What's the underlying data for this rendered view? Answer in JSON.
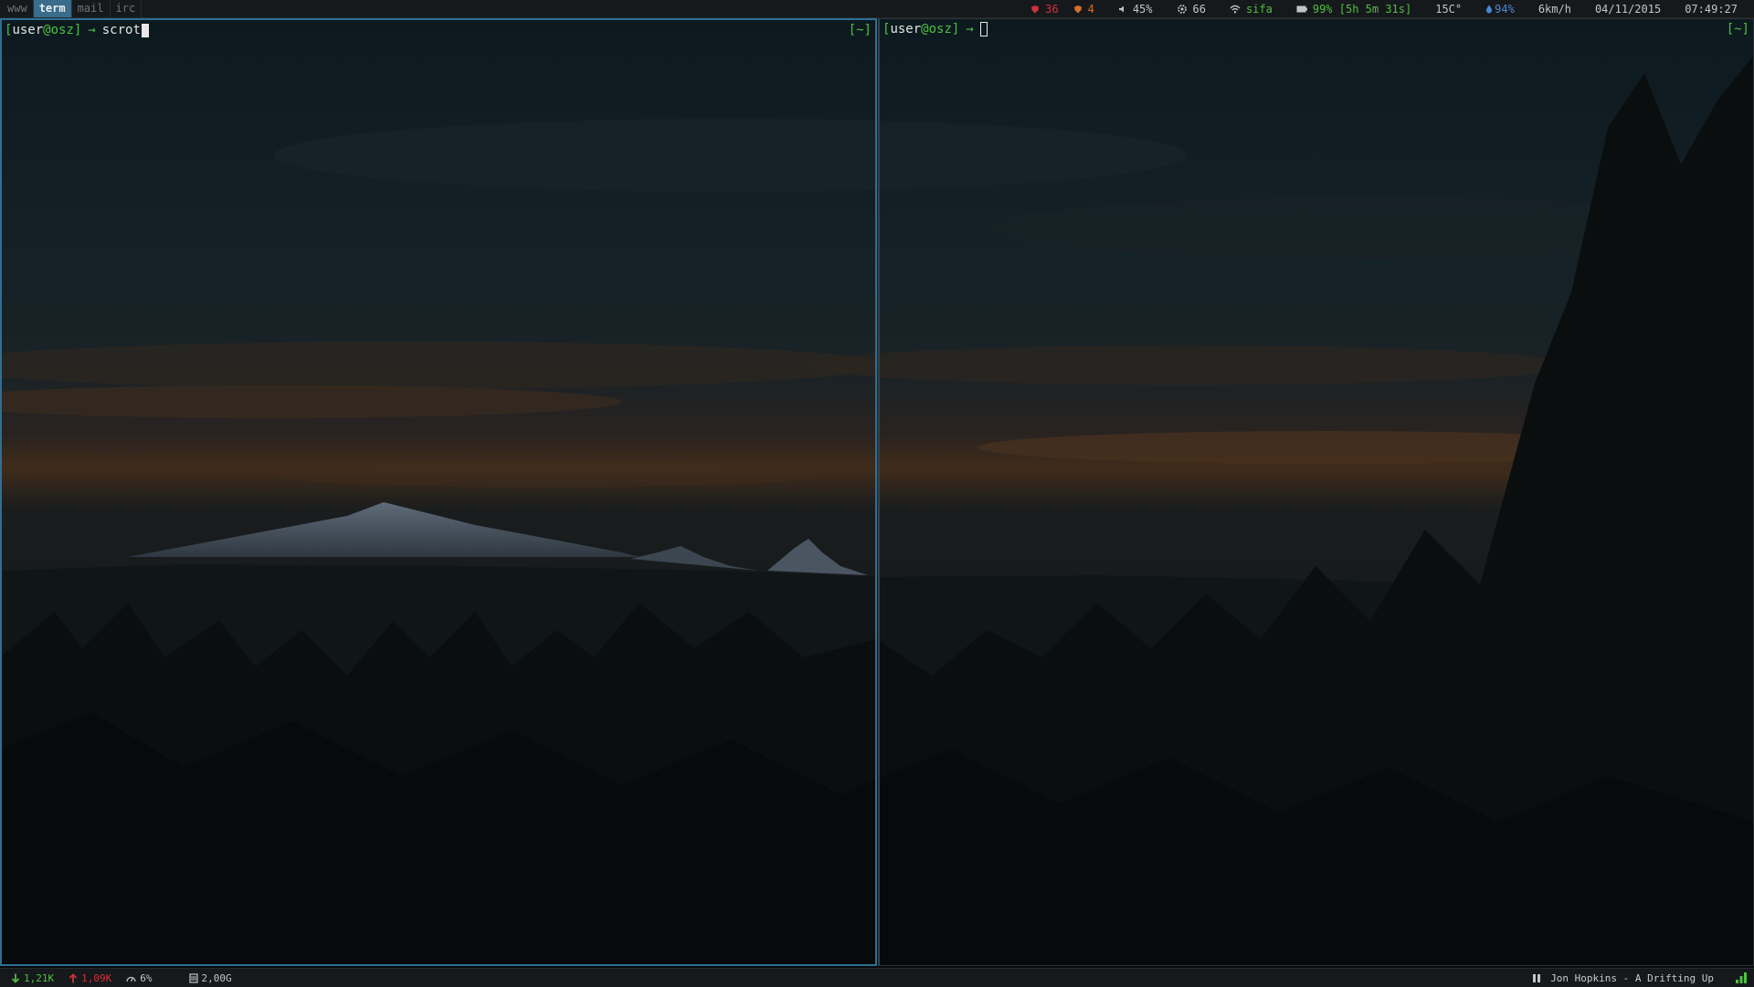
{
  "workspaces": [
    {
      "label": "www",
      "active": false
    },
    {
      "label": "term",
      "active": true
    },
    {
      "label": "mail",
      "active": false
    },
    {
      "label": "irc",
      "active": false
    }
  ],
  "status": {
    "updates_arch": "36",
    "updates_aur": "4",
    "volume": "45%",
    "cpu_load": "66",
    "wifi_ssid": "sifa",
    "battery": "99% [5h 5m 31s]",
    "temperature": "15C°",
    "humidity": "94%",
    "wind": "6km/h",
    "date": "04/11/2015",
    "time": "07:49:27"
  },
  "terminal_left": {
    "bracket_open": "[",
    "user": "user",
    "host": "@osz",
    "bracket_close": "]",
    "arrow": "→",
    "command": "scrot",
    "cwd": "[~]"
  },
  "terminal_right": {
    "bracket_open": "[",
    "user": "user",
    "host": "@osz",
    "bracket_close": "]",
    "arrow": "→",
    "command": "",
    "cwd": "[~]"
  },
  "bottombar": {
    "net_down": "1,21K",
    "net_up": "1,09K",
    "cpu_usage": "6%",
    "disk": "2,00G",
    "now_playing": "Jon Hopkins - A Drifting Up"
  },
  "colors": {
    "accent_green": "#4fbf40",
    "accent_blue": "#3a6c8c",
    "alert_red": "#d2303a",
    "alert_orange": "#d5702c",
    "info_blue": "#4a86d8",
    "bar_background": "#16191b"
  },
  "icons": {
    "updates_arch": "shield-heart-icon",
    "updates_aur": "shield-heart-icon",
    "volume": "speaker-icon",
    "cpu_load": "gear-icon",
    "wifi": "wifi-icon",
    "battery": "battery-icon",
    "humidity": "drop-icon",
    "net_down": "arrow-down-icon",
    "net_up": "arrow-up-icon",
    "cpu_usage": "gauge-icon",
    "disk": "disk-icon",
    "pause": "pause-icon",
    "signal": "signal-bars-icon"
  }
}
